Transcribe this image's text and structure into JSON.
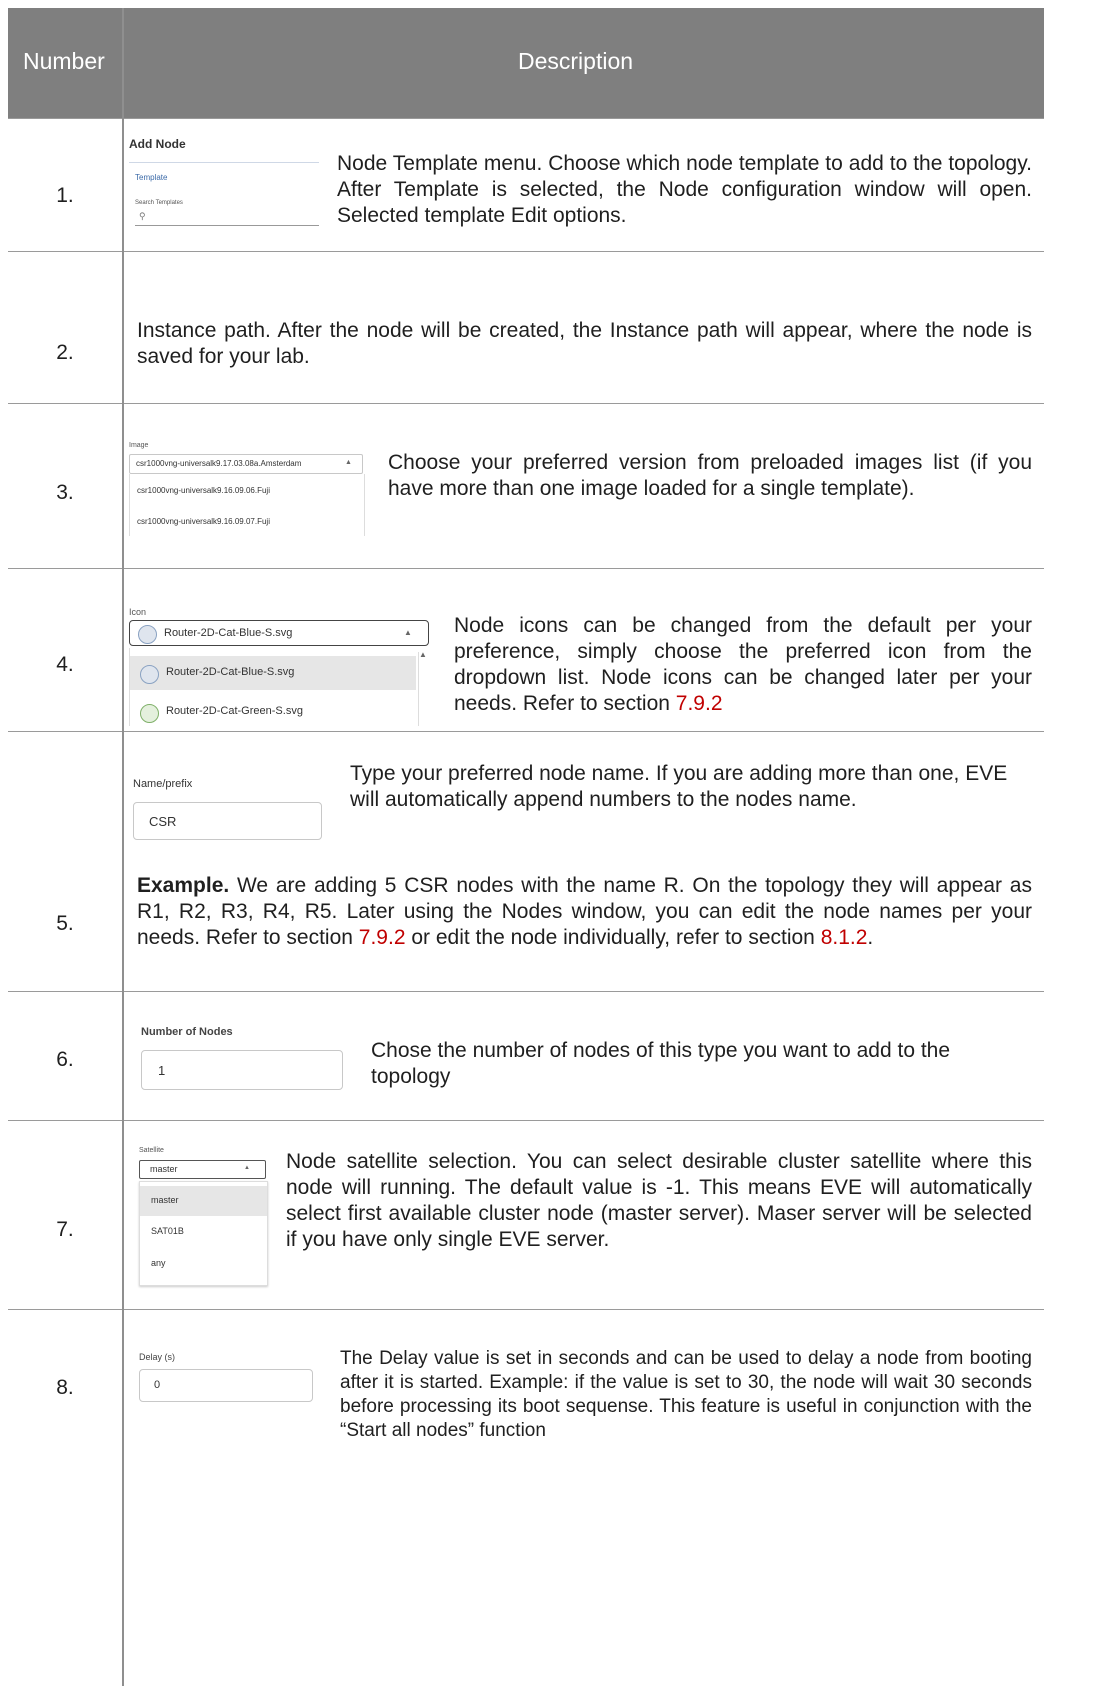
{
  "header": {
    "number": "Number",
    "description": "Description"
  },
  "rows": [
    {
      "number": "1.",
      "desc": "Node Template menu. Choose which node template to add to the topology. After Template is selected, the Node configuration window will open. Selected template Edit options.",
      "ui": {
        "title": "Add Node",
        "tab": "Template",
        "search_label": "Search Templates"
      }
    },
    {
      "number": "2.",
      "desc": "Instance path. After the node will be created, the Instance path will appear, where the node is saved for your lab."
    },
    {
      "number": "3.",
      "desc": "Choose your preferred version from preloaded images list (if you have more than one image loaded for a single template).",
      "ui": {
        "label": "Image",
        "selected": "csr1000vng-universalk9.17.03.08a.Amsterdam",
        "options": [
          "csr1000vng-universalk9.16.09.06.Fuji",
          "csr1000vng-universalk9.16.09.07.Fuji"
        ]
      }
    },
    {
      "number": "4.",
      "desc_prefix": "Node icons can be changed from the default per your preference, simply choose the preferred icon from the dropdown list. Node icons can be changed later per your needs. Refer to section ",
      "link": "7.9.2",
      "ui": {
        "label": "Icon",
        "selected": "Router-2D-Cat-Blue-S.svg",
        "options": [
          "Router-2D-Cat-Blue-S.svg",
          "Router-2D-Cat-Green-S.svg"
        ]
      }
    },
    {
      "number": "5.",
      "desc": "Type your preferred node name. If you are adding more than one, EVE will automatically append numbers to the nodes name.",
      "example_bold": "Example.",
      "example_text": " We are adding 5 CSR nodes with the name R. On the topology they will appear as R1, R2, R3, R4, R5. Later using the Nodes window, you can edit the node names per your needs. Refer to section ",
      "link1": "7.9.2",
      "mid": " or edit the node individually, refer to section ",
      "link2": "8.1.2",
      "end": ".",
      "ui": {
        "label": "Name/prefix",
        "value": "CSR"
      }
    },
    {
      "number": "6.",
      "desc": "Chose the number of nodes of this type you want to add to the topology",
      "ui": {
        "label": "Number of Nodes",
        "value": "1"
      }
    },
    {
      "number": "7.",
      "desc": "Node satellite selection. You can select desirable cluster satellite where this node will running. The default value is -1. This means EVE will automatically select first available cluster node (master server). Maser server will be selected if you have only single EVE server.",
      "ui": {
        "label": "Satellite",
        "selected": "master",
        "options": [
          "master",
          "SAT01B",
          "any"
        ]
      }
    },
    {
      "number": "8.",
      "desc": "The Delay value is set in seconds and can be used to delay a node from booting after it is started. Example: if the value is set to 30, the node will wait 30 seconds before processing its boot sequense. This feature is useful in conjunction with the “Start all nodes” function",
      "ui": {
        "label": "Delay (s)",
        "value": "0"
      }
    }
  ],
  "colors": {
    "header_bg": "#7f7f7f",
    "link": "#c00000",
    "grid": "#9a9a9a"
  }
}
